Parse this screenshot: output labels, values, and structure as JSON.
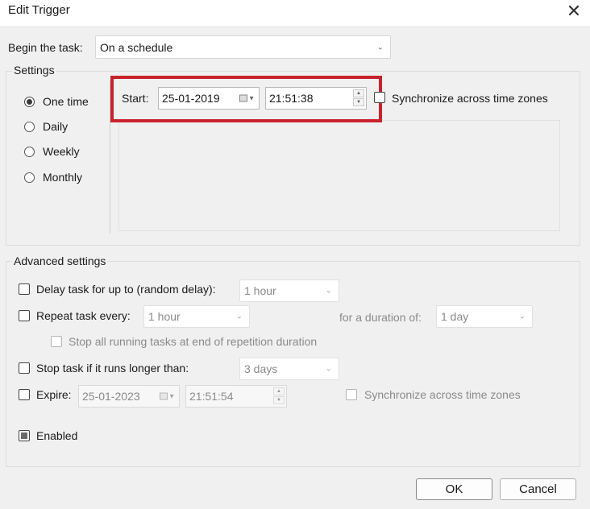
{
  "window": {
    "title": "Edit Trigger",
    "close_glyph": "✕"
  },
  "begin_task": {
    "label": "Begin the task:",
    "value": "On a schedule"
  },
  "settings": {
    "group_label": "Settings",
    "schedule_options": [
      {
        "label": "One time",
        "checked": true
      },
      {
        "label": "Daily",
        "checked": false
      },
      {
        "label": "Weekly",
        "checked": false
      },
      {
        "label": "Monthly",
        "checked": false
      }
    ],
    "start": {
      "label": "Start:",
      "date": "25-01-2019",
      "time": "21:51:38",
      "sync_label": "Synchronize across time zones"
    }
  },
  "advanced": {
    "group_label": "Advanced settings",
    "delay": {
      "label": "Delay task for up to (random delay):",
      "value": "1 hour"
    },
    "repeat": {
      "label": "Repeat task every:",
      "value": "1 hour",
      "duration_label": "for a duration of:",
      "duration_value": "1 day"
    },
    "stop_all": {
      "label": "Stop all running tasks at end of repetition duration"
    },
    "stop_longer": {
      "label": "Stop task if it runs longer than:",
      "value": "3 days"
    },
    "expire": {
      "label": "Expire:",
      "date": "25-01-2023",
      "time": "21:51:54",
      "sync_label": "Synchronize across time zones"
    },
    "enabled": {
      "label": "Enabled",
      "checked": true
    }
  },
  "buttons": {
    "ok": "OK",
    "cancel": "Cancel"
  },
  "colors": {
    "highlight": "#c8232c",
    "background": "#f0f0f0"
  }
}
